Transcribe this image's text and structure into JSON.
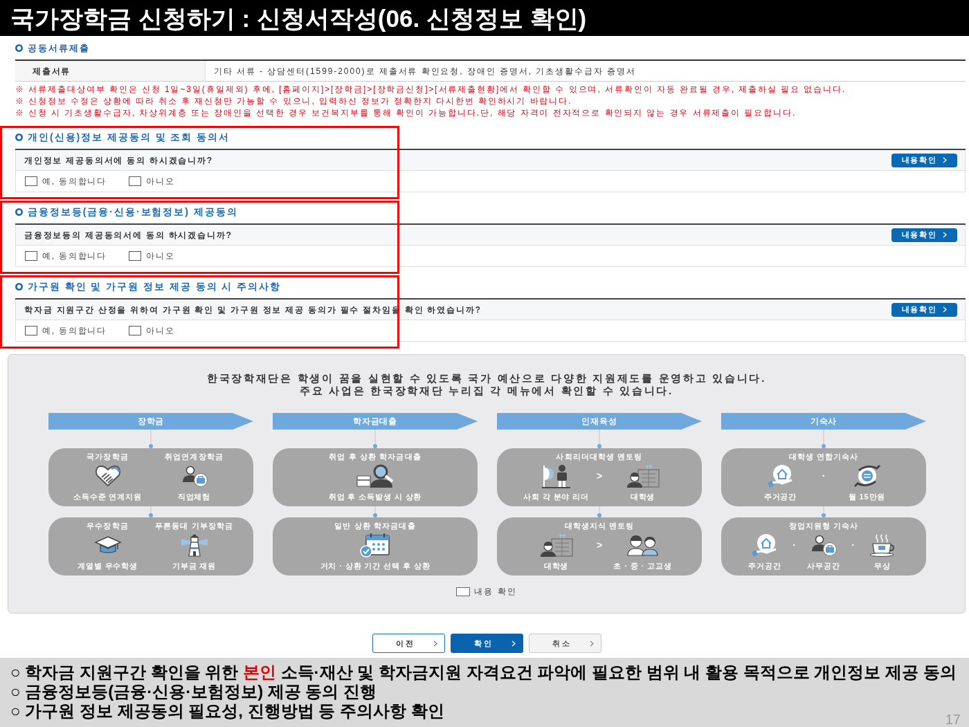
{
  "slide_title": "국가장학금 신청하기 : 신청서작성(06. 신청정보 확인)",
  "documents": {
    "heading": "공동서류제출",
    "label": "제출서류",
    "value": "기타 서류 - 상담센터(1599-2000)로 제출서류 확인요청, 장애인 증명서, 기초생활수급자 증명서",
    "notes": [
      "※ 서류제출대상여부 확인은 신청 1일~3일(휴일제외) 후에, [홈페이지]>[장학금]>[장학금신청]>[서류제출현황]에서 확인할 수 있으며, 서류확인이 자동 완료될 경우, 제출하실 필요 없습니다.",
      "※ 신청정보 수정은 상황에 따라 취소 후 재신청만 가능할 수 있으니, 입력하신 정보가 정확한지 다시한번 확인하시기 바랍니다.",
      "※ 신청 시 기초생활수급자, 차상위계층 또는 장애인을 선택한 경우 보건복지부를 통해 확인이 가능합니다.단, 해당 자격이 전자적으로 확인되지 않는 경우 서류제출이 필요합니다."
    ]
  },
  "consents": [
    {
      "heading": "개인(신용)정보 제공동의 및 조회 동의서",
      "question": "개인정보 제공동의서에 동의 하시겠습니까?",
      "button": "내용확인",
      "options": [
        {
          "label": "예, 동의합니다",
          "checked": false
        },
        {
          "label": "아니오",
          "checked": false
        }
      ],
      "highlighted": true
    },
    {
      "heading": "금융정보등(금융·신용·보험정보) 제공동의",
      "question": "금융정보등의 제공동의서에 동의 하시겠습니까?",
      "button": "내용확인",
      "options": [
        {
          "label": "예, 동의합니다",
          "checked": false
        },
        {
          "label": "아니오",
          "checked": false
        }
      ],
      "highlighted": true
    },
    {
      "heading": "가구원 확인 및 가구원 정보 제공 동의 시 주의사항",
      "question": "학자금 지원구간 산정을 위하여 가구원 확인 및 가구원 정보 제공 동의가 필수 절차임을 확인 하였습니까?",
      "button": "내용확인",
      "options": [
        {
          "label": "예, 동의합니다",
          "checked": false
        },
        {
          "label": "아니오",
          "checked": false
        }
      ],
      "highlighted": true
    }
  ],
  "info_panel": {
    "intro": [
      "한국장학재단은 학생이 꿈을 실현할 수 있도록 국가 예산으로 다양한 지원제도를 운영하고 있습니다.",
      "주요 사업은 한국장학재단 누리집 각 메뉴에서 확인할 수 있습니다."
    ],
    "categories": [
      {
        "title": "장학금",
        "cards": [
          {
            "items": [
              {
                "title": "국가장학금",
                "caption": "소득수준 연계지원"
              },
              {
                "title": "취업연계장학금",
                "caption": "직업체험"
              }
            ]
          },
          {
            "items": [
              {
                "title": "우수장학금",
                "caption": "계열별 우수학생"
              },
              {
                "title": "푸른등대 기부장학금",
                "caption": "기부금 재원"
              }
            ]
          }
        ]
      },
      {
        "title": "학자금대출",
        "cards": [
          {
            "title": "취업 후 상환 학자금대출",
            "items": [
              {
                "caption": "취업 후 소득발생 시 상환"
              }
            ]
          },
          {
            "title": "일반 상환 학자금대출",
            "items": [
              {
                "caption": "거치 · 상환 기간 선택 후 상환"
              }
            ]
          }
        ]
      },
      {
        "title": "인재육성",
        "cards": [
          {
            "title": "사회리더대학생 멘토링",
            "separators": [
              ">"
            ],
            "items": [
              {
                "caption": "사회 각 분야 리더"
              },
              {
                "caption": "대학생"
              }
            ]
          },
          {
            "title": "대학생지식 멘토링",
            "separators": [
              ">"
            ],
            "items": [
              {
                "caption": "대학생"
              },
              {
                "caption": "초 · 중 · 고교생"
              }
            ]
          }
        ]
      },
      {
        "title": "기숙사",
        "cards": [
          {
            "title": "대학생 연합기숙사",
            "separators": [
              "·"
            ],
            "items": [
              {
                "caption": "주거공간"
              },
              {
                "caption": "월 15만원"
              }
            ]
          },
          {
            "title": "창업지원형 기숙사",
            "separators": [
              "·",
              "·"
            ],
            "items": [
              {
                "caption": "주거공간"
              },
              {
                "caption": "사무공간"
              },
              {
                "caption": "무상"
              }
            ]
          }
        ]
      }
    ],
    "confirm": {
      "label": "내용 확인",
      "checked": false
    }
  },
  "buttons": [
    {
      "label": "이전",
      "kind": "outline"
    },
    {
      "label": "확인",
      "kind": "primary"
    },
    {
      "label": "취소",
      "kind": "secondary"
    }
  ],
  "summary": {
    "lines": [
      [
        {
          "text": "○ 학자금 지원구간 확인을 위한 ",
          "emphasis": false
        },
        {
          "text": "본인",
          "emphasis": true
        },
        {
          "text": " 소득·재산 및 학자금지원 자격요건 파악에 필요한 범위 내 활용 목적으로 개인정보 제공 동의",
          "emphasis": false
        }
      ],
      [
        {
          "text": "○ 금융정보등(금융·신용·보험정보) 제공 동의 진행",
          "emphasis": false
        }
      ],
      [
        {
          "text": "○ 가구원 정보 제공동의 필요성, 진행방법 등 주의사항 확인",
          "emphasis": false
        }
      ]
    ],
    "page_number": "17"
  }
}
